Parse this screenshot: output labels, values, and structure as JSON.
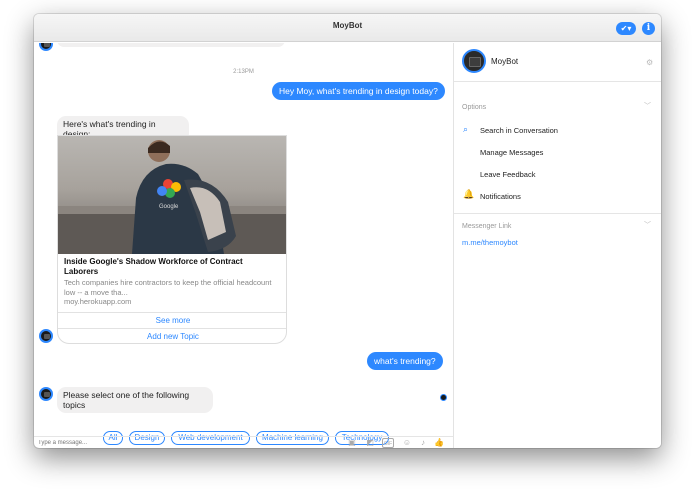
{
  "window": {
    "title": "MoyBot"
  },
  "chat": {
    "timestamp": "2:13PM",
    "messages": {
      "user1": "Hey Moy, what's trending in design today?",
      "bot1": "Here's what's trending in design:",
      "user2": "what's trending?",
      "bot2": "Please select one of the following topics"
    },
    "card": {
      "title": "Inside Google's Shadow Workforce of Contract Laborers",
      "description": "Tech companies hire contractors to keep the official headcount low -- a move tha...",
      "domain": "moy.herokuapp.com",
      "button1": "See more",
      "button2": "Add new Topic",
      "image_text": "Google"
    },
    "quick_replies": [
      "All",
      "Design",
      "Web development",
      "Machine learning",
      "Technology"
    ],
    "composer": {
      "placeholder": "Type a message..."
    },
    "composer_icons": [
      "camera-icon",
      "sticker-icon",
      "gif-icon",
      "emoji-icon",
      "microphone-icon",
      "thumbs-up-icon"
    ]
  },
  "sidebar": {
    "name": "MoyBot",
    "options_label": "Options",
    "items": [
      "Search in Conversation",
      "Manage Messages",
      "Leave Feedback",
      "Notifications"
    ],
    "messenger_link_label": "Messenger Link",
    "messenger_link": "m.me/themoybot"
  },
  "colors": {
    "accent": "#2d88ff",
    "bubble_in": "#f1f0f0"
  }
}
